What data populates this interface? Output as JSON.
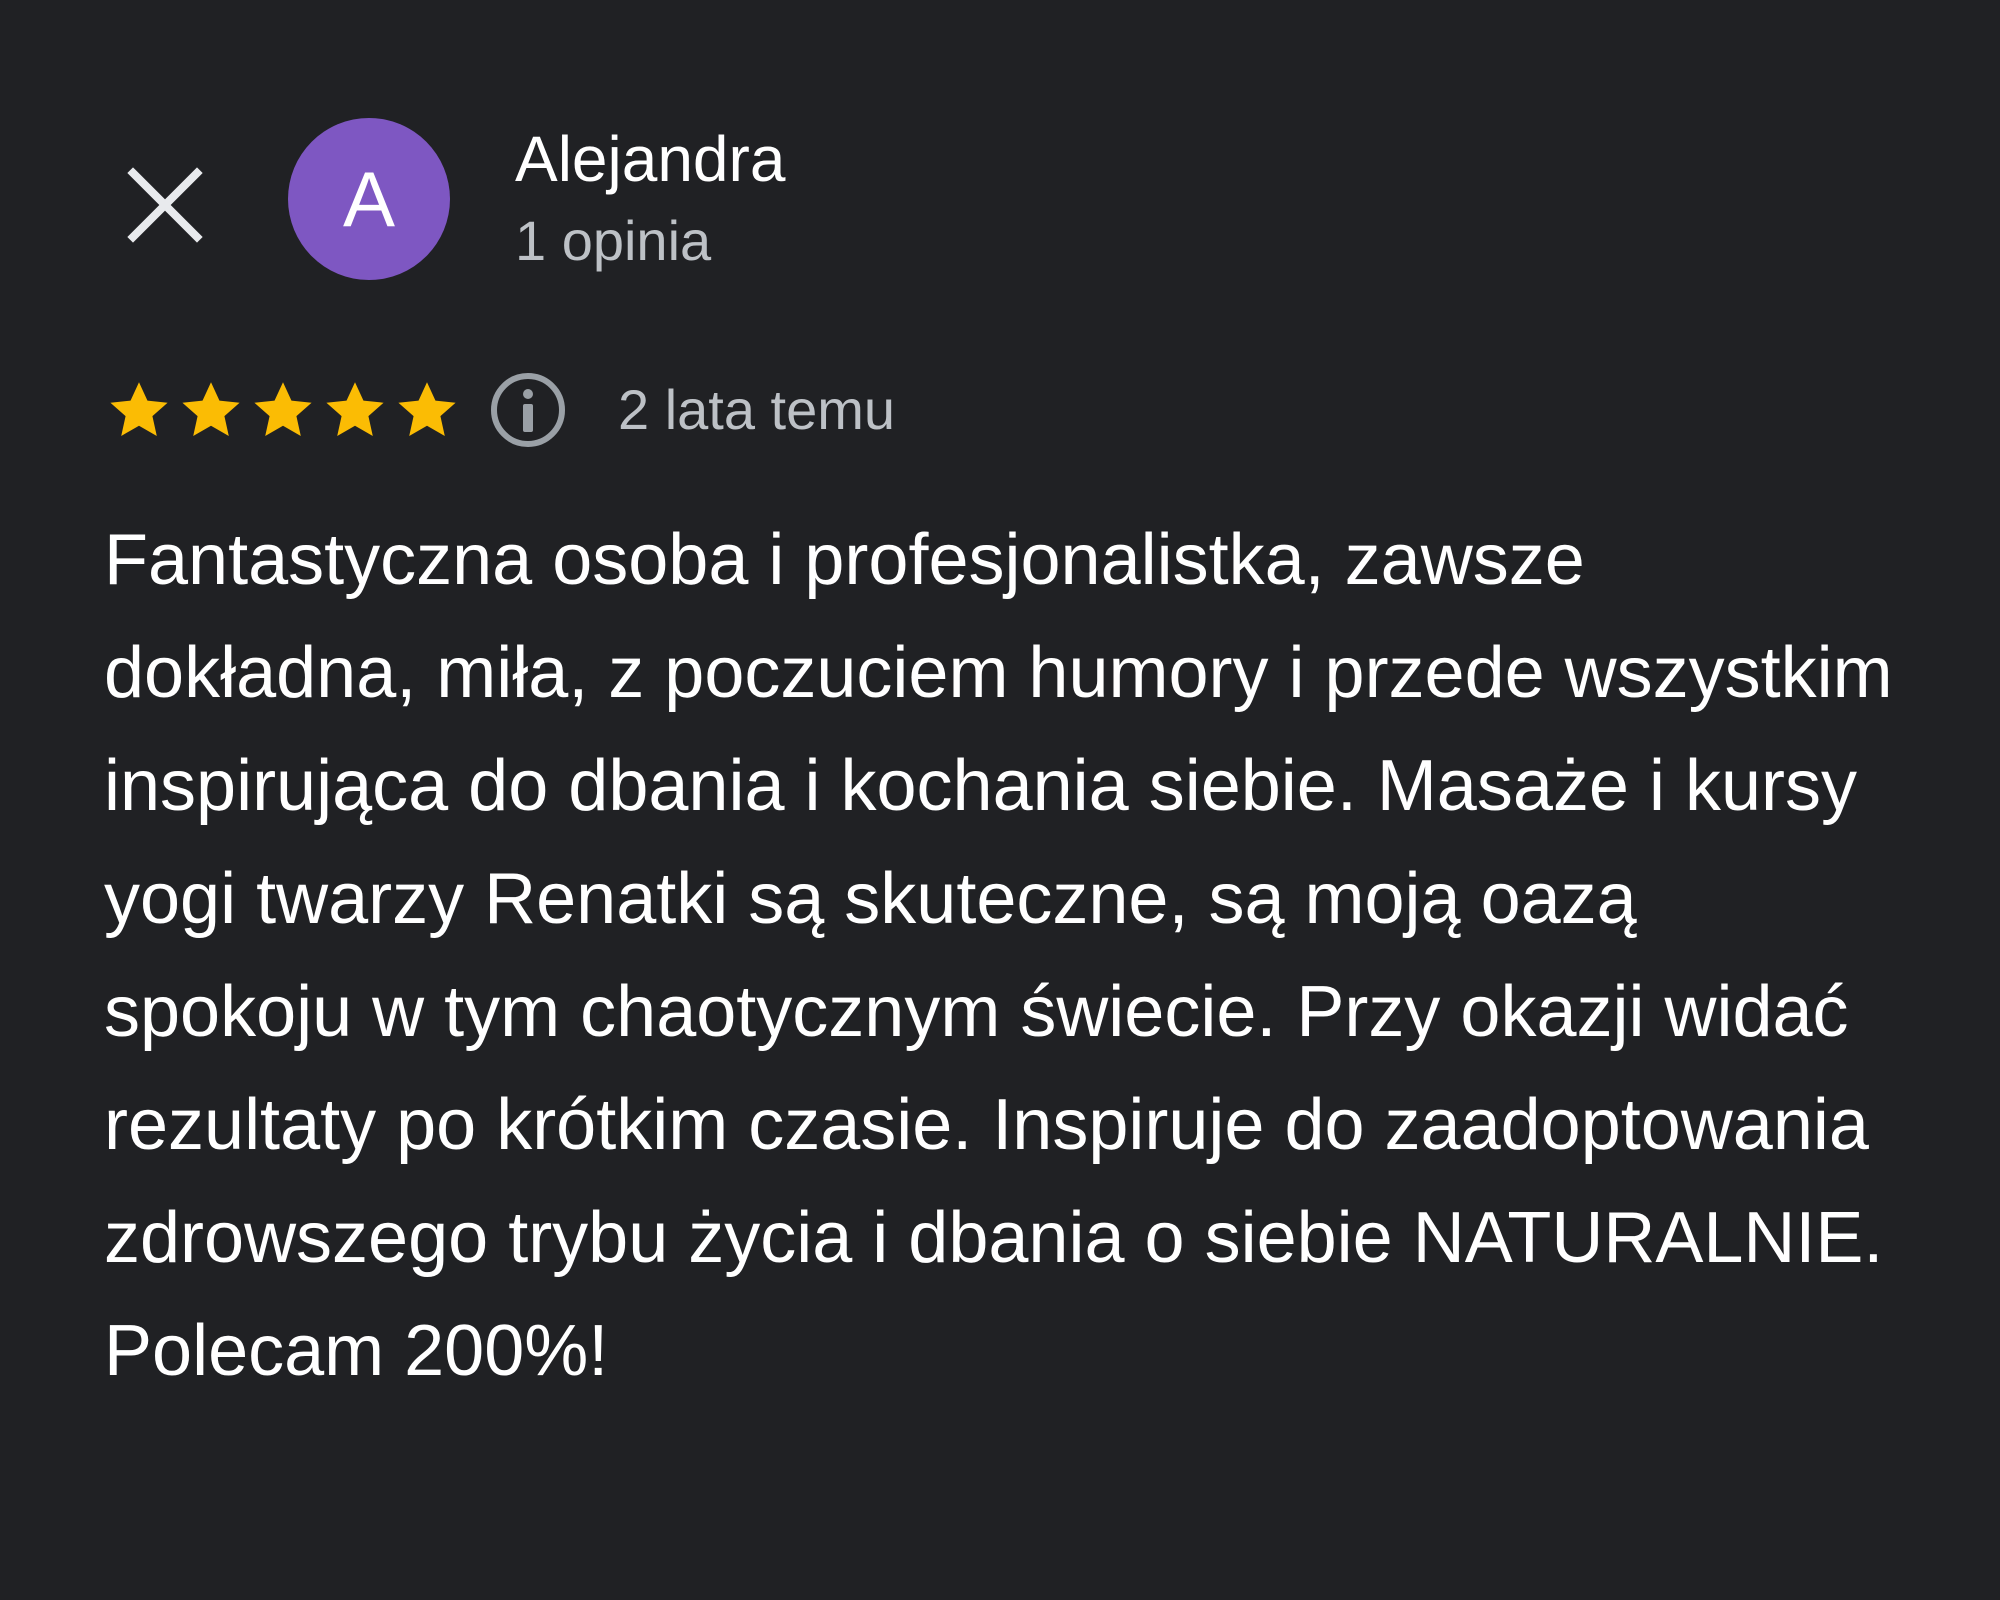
{
  "review": {
    "author": {
      "initial": "A",
      "name": "Alejandra",
      "review_count_text": "1 opinia",
      "avatar_color": "#7e57c2"
    },
    "rating": {
      "stars": 5,
      "max": 5,
      "star_color": "#fbbc04"
    },
    "date_text": "2 lata temu",
    "text": "Fantastyczna osoba i profesjonalistka, zawsze dokładna, miła, z poczuciem humory i przede wszystkim inspirująca do dbania i kochania siebie. Masaże i kursy yogi twarzy Renatki są skuteczne, są moją oazą spokoju w tym chaotycznym świecie. Przy okazji widać rezultaty po krótkim czasie. Inspiruje do zaadoptowania zdrowszego trybu życia i dbania o siebie NATURALNIE. Polecam 200%!"
  },
  "icons": {
    "close": "close-icon",
    "info": "info-icon",
    "star": "star-icon"
  },
  "colors": {
    "background": "#202124",
    "primary_text": "#ffffff",
    "secondary_text": "#bdc1c6"
  }
}
